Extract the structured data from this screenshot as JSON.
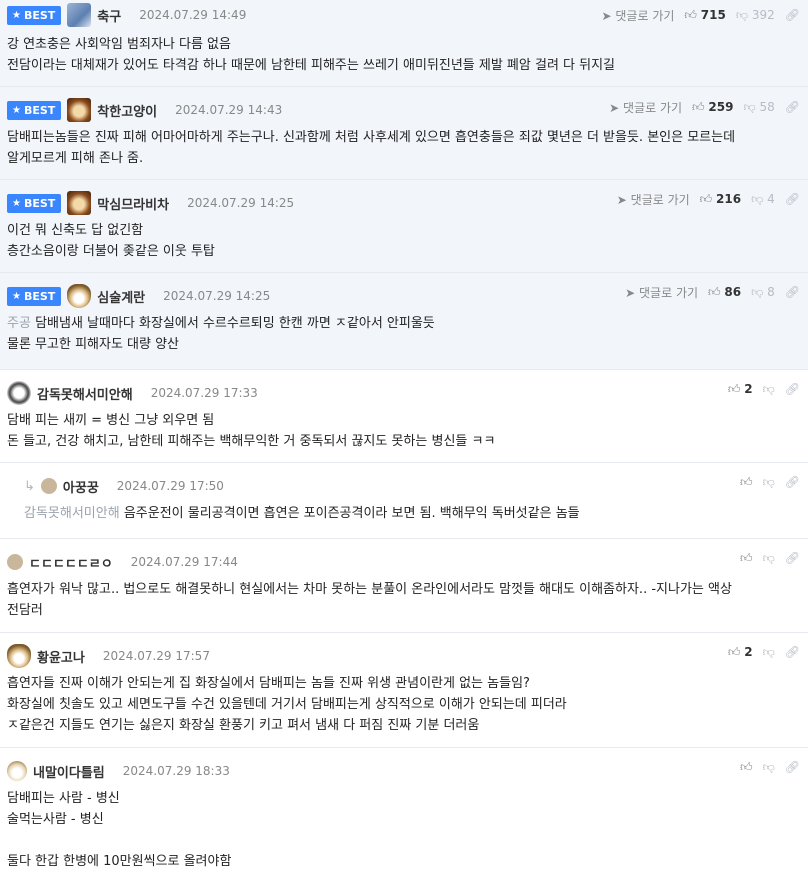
{
  "best_label": "BEST",
  "reply_link_label": "댓글로 가기",
  "comments": [
    {
      "nickname": "축구",
      "date": "2024.07.29 14:49",
      "likes": "715",
      "dislikes": "392",
      "lines": [
        "강 연초충은 사회악임 범죄자나 다름 없음",
        "전담이라는 대체재가 있어도 타격감 하나 때문에 남한테 피해주는 쓰레기 애미뒤진년들 제발 폐암 걸려 다 뒤지길"
      ]
    },
    {
      "nickname": "착한고양이",
      "date": "2024.07.29 14:43",
      "likes": "259",
      "dislikes": "58",
      "lines": [
        "담배피는놈들은 진짜 피해 어마어마하게 주는구나. 신과함께 처럼 사후세계 있으면 흡연충들은 죄값 몇년은 더 받을듯. 본인은 모르는데",
        "알게모르게 피해 존나 줌."
      ]
    },
    {
      "nickname": "막심므라비차",
      "date": "2024.07.29 14:25",
      "likes": "216",
      "dislikes": "4",
      "lines": [
        "이건 뭐 신축도 답 없긴함",
        "층간소음이랑 더불어 좆같은 이웃 투탑"
      ]
    },
    {
      "nickname": "심술계란",
      "date": "2024.07.29 14:25",
      "likes": "86",
      "dislikes": "8",
      "prefix": "주공",
      "lines": [
        "담배냄새 날때마다 화장실에서 수르수르퇴밍 한캔 까면 ㅈ같아서 안피울듯",
        "물론 무고한 피해자도 대량 양산"
      ]
    },
    {
      "nickname": "감독못해서미안해",
      "date": "2024.07.29 17:33",
      "likes": "2",
      "lines": [
        "담배 피는 새끼 = 병신 그냥 외우면 됨",
        "돈 들고, 건강 해치고, 남한테 피해주는 백해무익한 거 중독되서 끊지도 못하는 병신들 ㅋㅋ"
      ]
    },
    {
      "nickname": "아꿍꿍",
      "date": "2024.07.29 17:50",
      "mention": "감독못해서미안해",
      "lines": [
        "음주운전이 물리공격이면 흡연은 포이즌공격이라 보면 됨. 백해무익 독버섯같은 놈들"
      ]
    },
    {
      "nickname": "ㄷㄷㄷㄷㄷㄹㅇ",
      "date": "2024.07.29 17:44",
      "lines": [
        "흡연자가 워낙 많고.. 법으로도 해결못하니 현실에서는 차마 못하는 분풀이 온라인에서라도 맘껏들 해대도 이해좀하자.. -지나가는 액상",
        "전담러"
      ]
    },
    {
      "nickname": "황윤고나",
      "date": "2024.07.29 17:57",
      "likes": "2",
      "lines": [
        "흡연자들 진짜 이해가 안되는게 집 화장실에서 담배피는 놈들 진짜 위생 관념이란게 없는 놈들임?",
        "화장실에 칫솔도 있고 세면도구들 수건 있을텐데 거기서 담배피는게 상직적으로 이해가 안되는데 피더라",
        "ㅈ같은건 지들도 연기는 싫은지 화장실 환풍기 키고 펴서 냄새 다 퍼짐 진짜 기분 더러움"
      ]
    },
    {
      "nickname": "내말이다틀림",
      "date": "2024.07.29 18:33",
      "lines": [
        "담배피는 사람 - 병신",
        "술먹는사람 - 병신",
        "",
        "둘다 한갑 한병에 10만원씩으로 올려야함"
      ]
    }
  ]
}
